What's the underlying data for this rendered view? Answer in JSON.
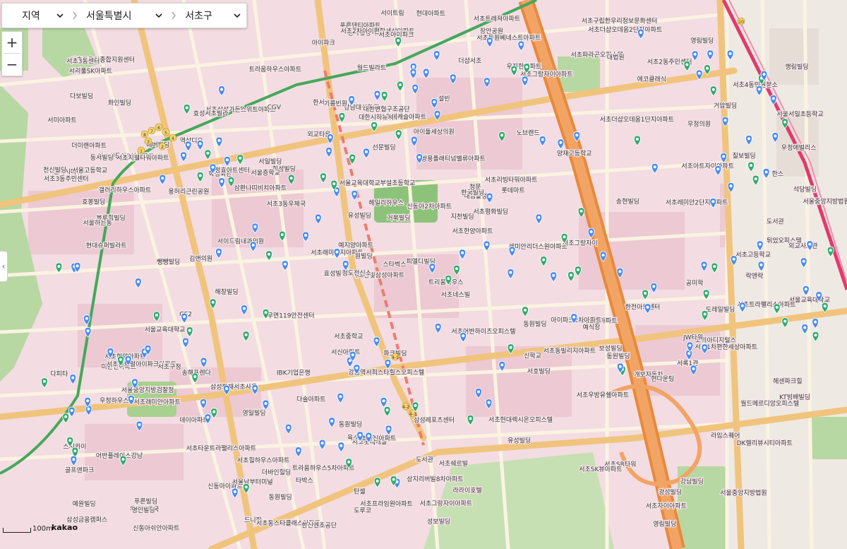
{
  "region": {
    "level1": "지역",
    "level2": "서울특별시",
    "level3": "서초구"
  },
  "zoom": {
    "in": "+",
    "out": "−"
  },
  "side_toggle": "‹",
  "scale": "100m",
  "logo": "kakao",
  "colors": {
    "base": "#f3dce2",
    "residential": "#ecc9d3",
    "park": "#b7d8a2",
    "sports": "#8dc27a",
    "road": "#fbf3e2",
    "road_edge": "#e7cf9e",
    "arterial": "#f0c47c",
    "highway": "#e8893b",
    "subway": "#44a85a",
    "rail_red": "#e23a6b",
    "marker_blue": "#4a8cf0",
    "marker_green": "#2faa6f",
    "label": "#3a3a3a"
  },
  "map_labels": [
    "서울중앙지방법원",
    "블루힐빌딩",
    "서초4동민원분소",
    "효성빌딩",
    "노브랜드",
    "푸른빌딩",
    "강남대성학원",
    "쌍용플래티넘밸류아파트",
    "서울중앙지방검찰청",
    "희성빌딩",
    "골프앤파크",
    "서초타운트라팰리스아파트",
    "대한변협구조공단",
    "대검찰청",
    "예식장",
    "화인빌딩",
    "정곡빌딩서관",
    "서울중앙지방법원",
    "동원빌딩",
    "칠보빌딩",
    "예지양아파트",
    "동원빌딩",
    "유성빌딩",
    "서초삼성가든스위트아파트",
    "서초파라곤오피스텔",
    "삼성화재서초사옥",
    "광성빌딩",
    "라임스퀘어",
    "SK허브밸아파트",
    "성보빌딩",
    "서울증학교",
    "용허리근린공원",
    "서호빌딩",
    "신동아이파트",
    "한스",
    "지천빌딩",
    "예원빌딩",
    "서초롯데캐슬",
    "서초한양아파트",
    "우정하우스",
    "우정의원",
    "행림빌딩",
    "서초동빌리지아파트",
    "유성빌딩",
    "데이아파트",
    "신동아쉬안아파트",
    "삼성금융캠퍼스",
    "삼성레포츠센터",
    "서초2동주민센터",
    "서이트림",
    "서이드림내과의원",
    "갤럭시타워",
    "역삼디오",
    "대법원",
    "우편취급국",
    "장안공원",
    "아이파크",
    "헤일리하우스",
    "헤센파크힐",
    "강남역서희스타힐스오피스텔",
    "더바인힐딩",
    "아이파크2차아파트",
    "학생회관",
    "스시카이",
    "서초이뉴빌",
    "에버빌딩",
    "서울교육대학교",
    "서울교육대학교부설초등학교",
    "도서관",
    "신동아2차아파트",
    "어반플레이스강남",
    "레미안리더스원아파트",
    "코리아디지털스",
    "탄셀",
    "타워1",
    "파크빌딩",
    "서초SR타워",
    "서초그랑자이아파트",
    "서초현대렉시온오피스텔",
    "푸른댄티아파트",
    "락앤락",
    "롯데마트",
    "서초우방유쉘아파트",
    "거북빌딩",
    "서록1관",
    "서초3동주민센터",
    "서초프라임원아파트",
    "우진한아파트",
    "서초그랑자이아파트",
    "뺑뺑빌딩",
    "드니판",
    "서초고등학교",
    "석당빌딩",
    "서울교육대학교",
    "송해프렌다",
    "서초힐하우스아파트",
    "한국빌딩",
    "에코클래식",
    "서초3동우체국",
    "공미학",
    "서리풀SK아파트",
    "서초롯데캐슬아파트",
    "서초래미안지아파트",
    "서초동스타클래스아파트",
    "다피타",
    "서초한빛삼성아파트",
    "영림빌딩",
    "한서스",
    "한신엔조공단",
    "미원건아파트",
    "영림빌딩",
    "아이들세상의원",
    "CGV",
    "서초그랑자이",
    "CS2",
    "강남빌딩",
    "타박스",
    "송현빌딩",
    "다보빌딩",
    "서초센트럴아이파크아파트",
    "라라이호텔",
    "정효아트센터",
    "트라움하우스아파트",
    "도레일빌딩",
    "동원빌딩",
    "해창빌딩",
    "서초한양아파트",
    "서초트라팰리스아파트",
    "서일빌딩",
    "트리움하우스",
    "갤러리하우스아파트",
    "개보자동차",
    "피엘디빌딩",
    "청문",
    "서초구육아종합지원센터",
    "트라움하우스5차아파트",
    "서초SK뷰아파트",
    "육스포드빌아파트",
    "서초2차아이편한세상아파트",
    "서초아트자이아파트",
    "효성서초빌라",
    "천신빌딩",
    "동원빌딩",
    "한전아트센터",
    "현대아파트",
    "월드빌라트",
    "선문빌딩",
    "김앤의원",
    "설빈",
    "서초어반하이츠오피스텔",
    "서초아이파크",
    "튀었오피스텔",
    "도루코",
    "서초동원베네스트아파트",
    "더미랜아파트",
    "서초중학교",
    "DK렐리뷰시티아파트",
    "명인빌딩",
    "서초자이아파트",
    "현다운팅",
    "서초쉐르빌",
    "우정애벌리스",
    "서초트레져아파트",
    "서초리빙타워아파트",
    "서울남부터미널",
    "더샵서초",
    "신학교",
    "서울서일초등학교",
    "서초신동아2차아파트",
    "서미아파트",
    "스타벅스",
    "상지리버빌8차아파트",
    "서울고등학교",
    "서초3동센터",
    "서초지웰타워아파트",
    "동서빌딩",
    "효봉빌딩",
    "영일빌딩",
    "원빌딩",
    "JW타워",
    "IBK기업은행",
    "대한시하뉴셔",
    "서초더샵오데움1단지아파트",
    "서초평화빌딩",
    "서초한신아파트",
    "현대슈퍼빌라트",
    "기름빈원",
    "보성빌딩",
    "서초구청",
    "서울하는동",
    "서초구립한우리정보문화센터",
    "외교타운",
    "도서관",
    "양재고등학교",
    "외교사료관",
    "정도전신소",
    "KT빙배빌딩",
    "서신아파트",
    "서초더샵오데움2단지아파트",
    "월드메르디앙오피스텔",
    "거암빌딩",
    "삼환나띠비치아파트",
    "서초1차편한세상아파트",
    "서초레미안2단지아파트",
    "다솔아파트",
    "서초래미안아파트",
    "서초네스빌",
    "우면119안전센터"
  ],
  "station_numbers": [
    "8",
    "7",
    "6",
    "5",
    "4",
    "3",
    "2",
    "1",
    "4-1",
    "4-2",
    "4-3",
    "10"
  ]
}
